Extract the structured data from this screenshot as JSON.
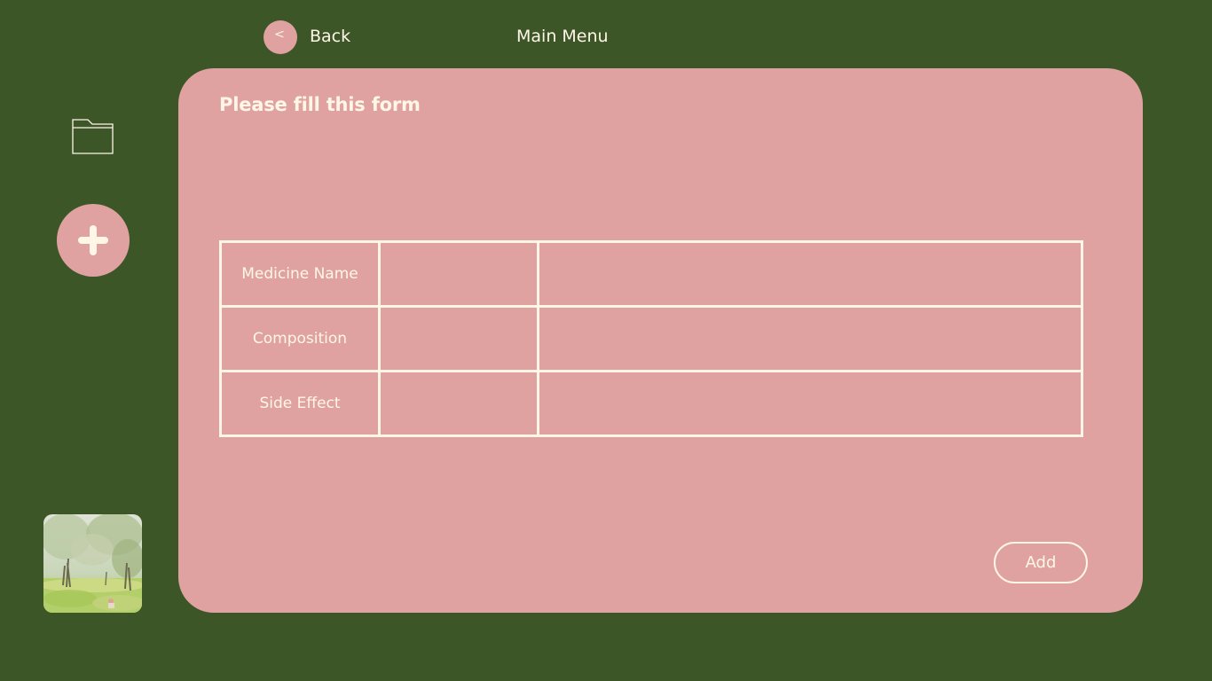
{
  "header": {
    "back_glyph": "<",
    "back_label": "Back",
    "main_menu_label": "Main Menu"
  },
  "sidebar": {
    "icons": [
      "folder-icon",
      "plus-icon"
    ],
    "thumbnail": "painting-thumbnail"
  },
  "form": {
    "title": "Please fill this form",
    "rows": [
      {
        "label": "Medicine Name",
        "value": "",
        "extra": ""
      },
      {
        "label": "Composition",
        "value": "",
        "extra": ""
      },
      {
        "label": "Side Effect",
        "value": "",
        "extra": ""
      }
    ],
    "add_label": "Add"
  },
  "colors": {
    "background": "#3d5627",
    "panel": "#e0a2a0",
    "text": "#fff6e8"
  }
}
